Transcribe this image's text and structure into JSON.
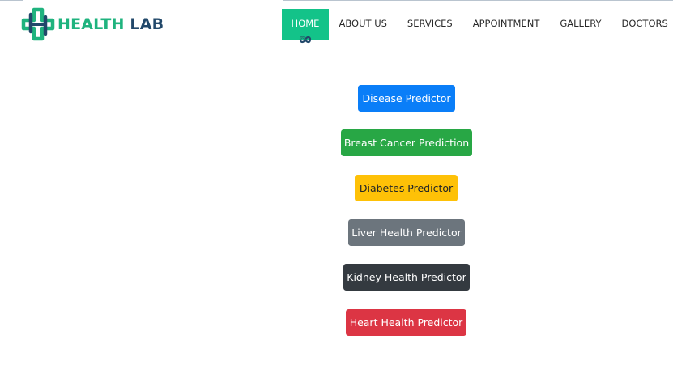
{
  "brand": {
    "name_part1": "HEALTH",
    "name_part2": " LAB",
    "logo_icon": "medical-cross-logo-icon",
    "colors": {
      "green": "#1fb37e",
      "navy": "#22486a"
    }
  },
  "nav": {
    "items": [
      {
        "label": "HOME",
        "active": true
      },
      {
        "label": "ABOUT US"
      },
      {
        "label": "SERVICES"
      },
      {
        "label": "APPOINTMENT"
      },
      {
        "label": "GALLERY"
      },
      {
        "label": "DOCTORS"
      }
    ],
    "active_color": "#13c389",
    "active_icon": "infinity-ornament-icon"
  },
  "predictors": {
    "disease": "Disease Predictor",
    "breast_cancer": "Breast Cancer Prediction",
    "diabetes": "Diabetes Predictor",
    "liver": "Liver Health Predictor",
    "kidney": "Kidney Health Predictor",
    "heart": "Heart Health Predictor"
  },
  "button_colors": {
    "primary": "#0a7ef8",
    "success": "#28a745",
    "warning": "#fec107",
    "secondary": "#6c757d",
    "dark": "#343a40",
    "danger": "#dc3544"
  }
}
